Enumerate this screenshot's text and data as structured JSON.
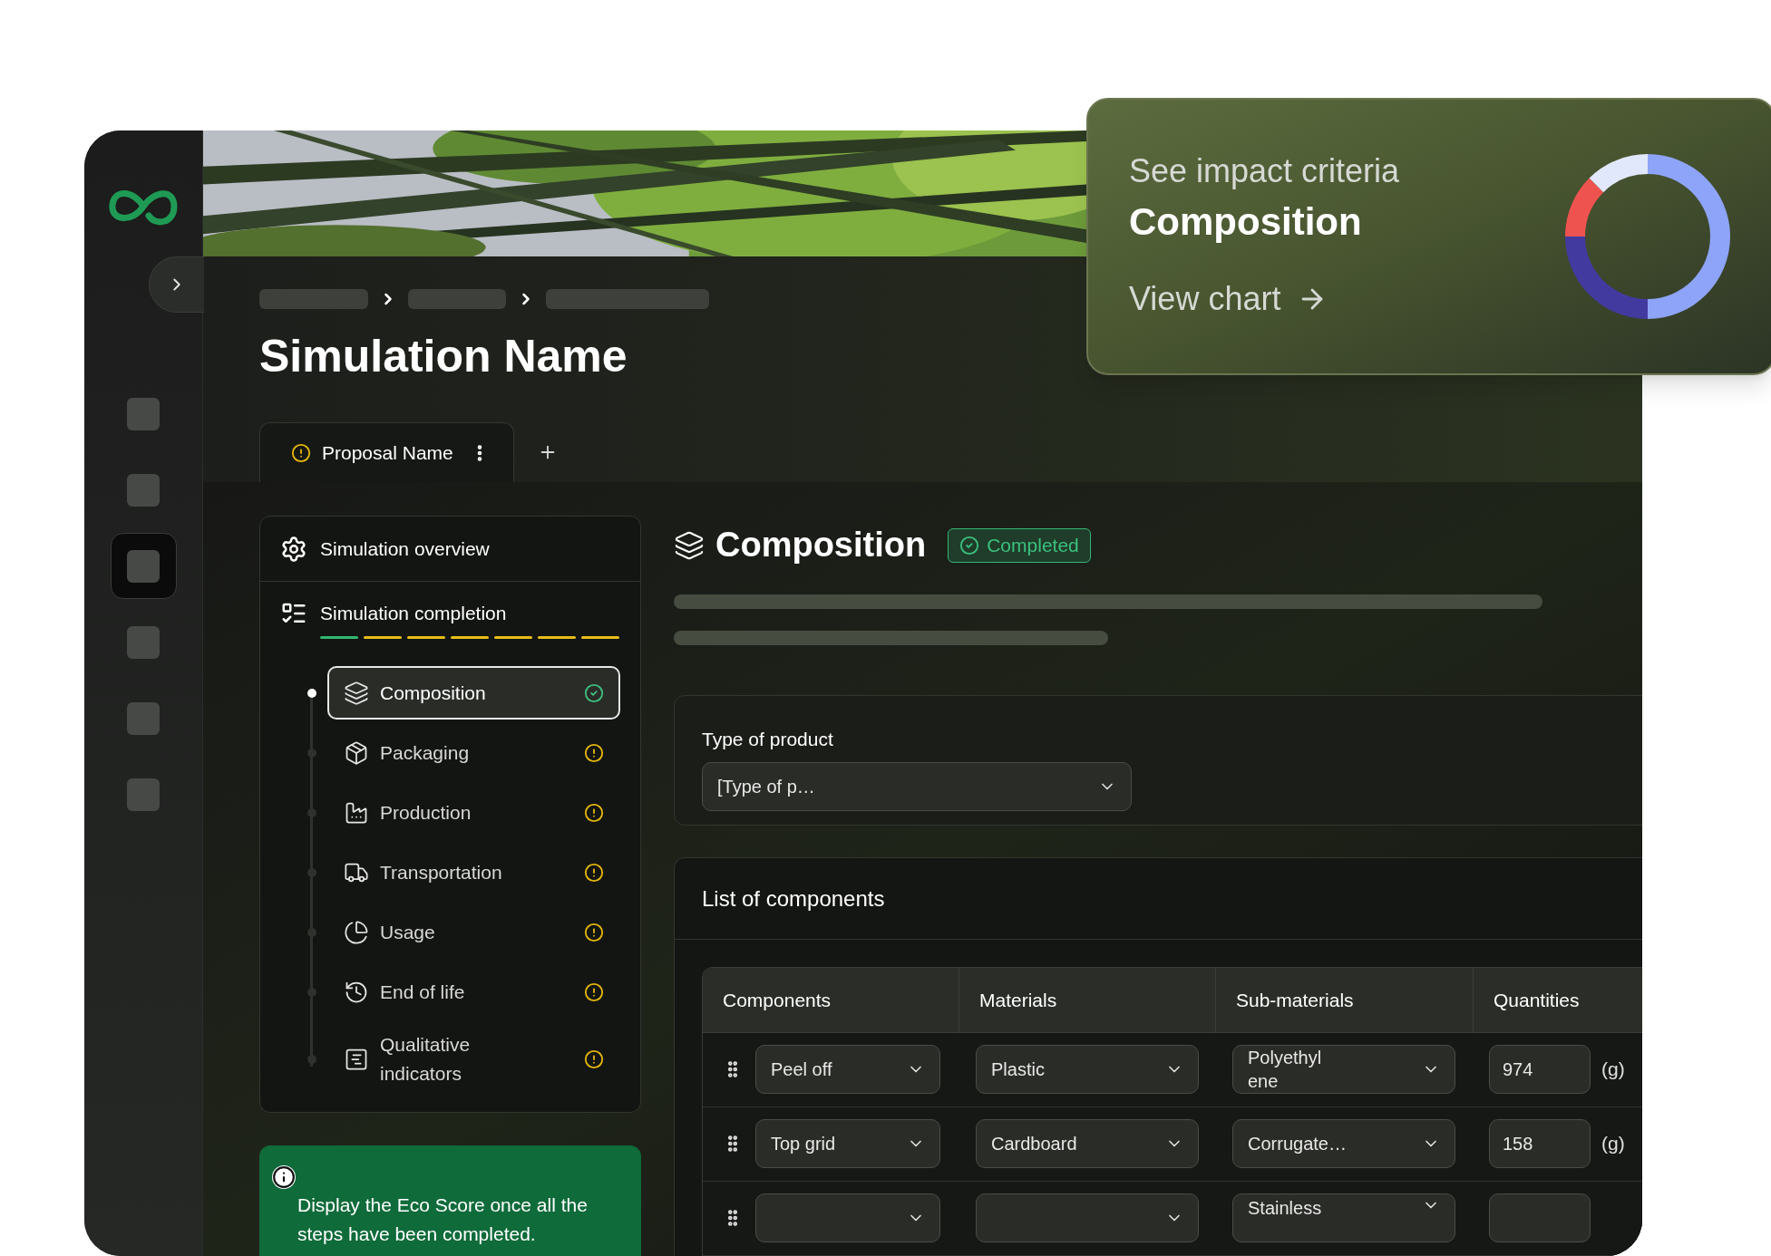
{
  "rail_items": [
    {
      "selected": false
    },
    {
      "selected": false
    },
    {
      "selected": true
    },
    {
      "selected": false
    },
    {
      "selected": false
    },
    {
      "selected": false
    }
  ],
  "page_title": "Simulation Name",
  "tabs": [
    {
      "label": "Proposal Name",
      "complete": false,
      "selected": true
    }
  ],
  "nav": {
    "overview": "Simulation overview",
    "completion": "Simulation completion",
    "steps": [
      {
        "label": "Composition",
        "complete": true,
        "selected": true
      },
      {
        "label": "Packaging",
        "complete": false,
        "selected": false
      },
      {
        "label": "Production",
        "complete": false,
        "selected": false
      },
      {
        "label": "Transportation",
        "complete": false,
        "selected": false
      },
      {
        "label": "Usage",
        "complete": false,
        "selected": false
      },
      {
        "label": "End of life",
        "complete": false,
        "selected": false
      },
      {
        "label": "Qualitative indicators",
        "complete": false,
        "selected": false
      }
    ]
  },
  "eco_notice": "Display the Eco Score once all the steps have been completed.",
  "section": {
    "title": "Composition",
    "badge": "Completed"
  },
  "product_type": {
    "label": "Type of product",
    "value": "[Type of p…"
  },
  "components": {
    "title": "List of components",
    "columns": [
      "Components",
      "Materials",
      "Sub-materials",
      "Quantities"
    ],
    "rows": [
      {
        "component": "Peel off",
        "material": "Plastic",
        "sub_material": "Polyethyl ene",
        "quantity": "974",
        "unit": "(g)"
      },
      {
        "component": "Top grid",
        "material": "Cardboard",
        "sub_material": "Corrugate…",
        "quantity": "158",
        "unit": "(g)"
      },
      {
        "sub_material": "Stainless"
      }
    ]
  },
  "impact_card": {
    "eyebrow": "See impact criteria",
    "title": "Composition",
    "link": "View chart"
  }
}
